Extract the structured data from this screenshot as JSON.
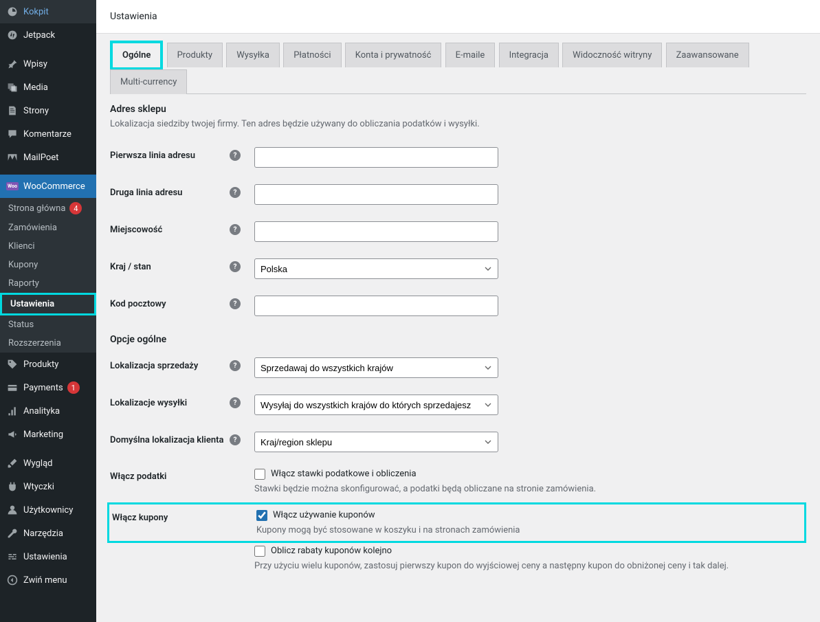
{
  "header": {
    "title": "Ustawienia"
  },
  "sidebar": {
    "items": [
      {
        "label": "Kokpit"
      },
      {
        "label": "Jetpack"
      },
      {
        "label": "Wpisy"
      },
      {
        "label": "Media"
      },
      {
        "label": "Strony"
      },
      {
        "label": "Komentarze"
      },
      {
        "label": "MailPoet"
      },
      {
        "label": "WooCommerce"
      },
      {
        "label": "Produkty"
      },
      {
        "label": "Payments",
        "badge": "1"
      },
      {
        "label": "Analityka"
      },
      {
        "label": "Marketing"
      },
      {
        "label": "Wygląd"
      },
      {
        "label": "Wtyczki"
      },
      {
        "label": "Użytkownicy"
      },
      {
        "label": "Narzędzia"
      },
      {
        "label": "Ustawienia"
      },
      {
        "label": "Zwiń menu"
      }
    ],
    "submenu": [
      {
        "label": "Strona główna",
        "badge": "4"
      },
      {
        "label": "Zamówienia"
      },
      {
        "label": "Klienci"
      },
      {
        "label": "Kupony"
      },
      {
        "label": "Raporty"
      },
      {
        "label": "Ustawienia"
      },
      {
        "label": "Status"
      },
      {
        "label": "Rozszerzenia"
      }
    ]
  },
  "tabs": [
    "Ogólne",
    "Produkty",
    "Wysyłka",
    "Płatności",
    "Konta i prywatność",
    "E-maile",
    "Integracja",
    "Widoczność witryny",
    "Zaawansowane",
    "Multi-currency"
  ],
  "help_char": "?",
  "sections": {
    "address": {
      "heading": "Adres sklepu",
      "desc": "Lokalizacja siedziby twojej firmy. Ten adres będzie używany do obliczania podatków i wysyłki.",
      "fields": {
        "line1": {
          "label": "Pierwsza linia adresu",
          "value": ""
        },
        "line2": {
          "label": "Druga linia adresu",
          "value": ""
        },
        "city": {
          "label": "Miejscowość",
          "value": ""
        },
        "country": {
          "label": "Kraj / stan",
          "value": "Polska"
        },
        "postcode": {
          "label": "Kod pocztowy",
          "value": ""
        }
      }
    },
    "general": {
      "heading": "Opcje ogólne",
      "fields": {
        "selling_location": {
          "label": "Lokalizacja sprzedaży",
          "value": "Sprzedawaj do wszystkich krajów"
        },
        "shipping_location": {
          "label": "Lokalizacje wysyłki",
          "value": "Wysyłaj do wszystkich krajów do których sprzedajesz"
        },
        "default_customer": {
          "label": "Domyślna lokalizacja klienta",
          "value": "Kraj/region sklepu"
        },
        "taxes": {
          "label": "Włącz podatki",
          "checkbox_label": "Włącz stawki podatkowe i obliczenia",
          "hint": "Stawki będzie można skonfigurować, a podatki będą obliczane na stronie zamówienia."
        },
        "coupons": {
          "label": "Włącz kupony",
          "checkbox1_label": "Włącz używanie kuponów",
          "hint1": "Kupony mogą być stosowane w koszyku i na stronach zamówienia",
          "checkbox2_label": "Oblicz rabaty kuponów kolejno",
          "hint2": "Przy użyciu wielu kuponów, zastosuj pierwszy kupon do wyjściowej ceny a następny kupon do obniżonej ceny i tak dalej."
        }
      }
    }
  }
}
